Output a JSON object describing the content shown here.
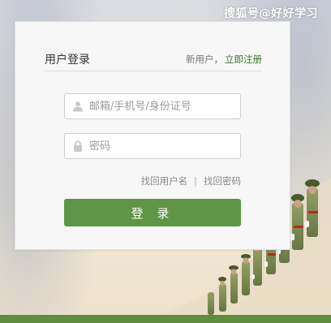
{
  "watermark": "搜狐号@好好学习",
  "login": {
    "title": "用户登录",
    "new_user_prefix": "新用户，",
    "register_link": "立即注册",
    "account_placeholder": "邮箱/手机号/身份证号",
    "password_placeholder": "密码",
    "forgot_username": "找回用户名",
    "separator": "|",
    "forgot_password": "找回密码",
    "submit_label": "登 录"
  },
  "colors": {
    "accent_green": "#5f9546",
    "link_green": "#3a7a2a",
    "bottom_bar": "#5e8d3f"
  },
  "icons": {
    "account": "user-icon",
    "password": "lock-icon"
  }
}
